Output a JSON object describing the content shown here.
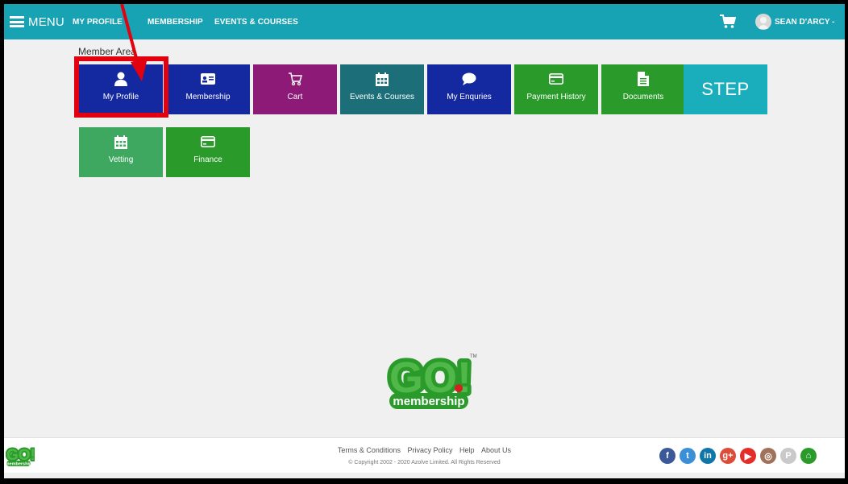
{
  "header": {
    "menu_label": "MENU",
    "nav": [
      "MY PROFILE",
      "MEMBERSHIP",
      "EVENTS & COURSES"
    ],
    "user_name": "SEAN D'ARCY -"
  },
  "main": {
    "section_title": "Member Area",
    "tiles": [
      {
        "label": "My Profile",
        "icon": "user-icon",
        "color": "#1428a0"
      },
      {
        "label": "Membership",
        "icon": "id-card-icon",
        "color": "#1428a0"
      },
      {
        "label": "Cart",
        "icon": "cart-icon",
        "color": "#8e1a77"
      },
      {
        "label": "Events & Courses",
        "icon": "calendar-icon",
        "color": "#1c6f78"
      },
      {
        "label": "My Enquries",
        "icon": "chat-bubble-icon",
        "color": "#1428a0"
      },
      {
        "label": "Payment History",
        "icon": "credit-card-icon",
        "color": "#2a9b2a"
      },
      {
        "label": "Documents",
        "icon": "document-icon",
        "color": "#2a9b2a"
      },
      {
        "label": "STEP",
        "icon": "",
        "color": "#1aaebd"
      },
      {
        "label": "Vetting",
        "icon": "calendar-icon",
        "color": "#3fa860"
      },
      {
        "label": "Finance",
        "icon": "credit-card-icon",
        "color": "#2a9b2a"
      }
    ]
  },
  "logo": {
    "brand_text": "GO!",
    "sub_text": "membership",
    "tm": "TM"
  },
  "footer": {
    "links": [
      "Terms & Conditions",
      "Privacy Policy",
      "Help",
      "About Us"
    ],
    "copyright": "© Copyright 2002 - 2020 Azolve Limited. All Rights Reserved",
    "social": [
      {
        "icon": "facebook-icon",
        "color": "#3b5998",
        "glyph": "f"
      },
      {
        "icon": "twitter-icon",
        "color": "#3a8fd6",
        "glyph": "t"
      },
      {
        "icon": "linkedin-icon",
        "color": "#0e76a8",
        "glyph": "in"
      },
      {
        "icon": "google-plus-icon",
        "color": "#dd4b39",
        "glyph": "g+"
      },
      {
        "icon": "youtube-icon",
        "color": "#e52d27",
        "glyph": "▶"
      },
      {
        "icon": "instagram-icon",
        "color": "#a0725a",
        "glyph": "◎"
      },
      {
        "icon": "pinterest-icon",
        "color": "#c9c9c9",
        "glyph": "P"
      },
      {
        "icon": "home-icon",
        "color": "#2a9b2a",
        "glyph": "⌂"
      }
    ]
  },
  "annotation": {
    "color": "#e3000f"
  }
}
